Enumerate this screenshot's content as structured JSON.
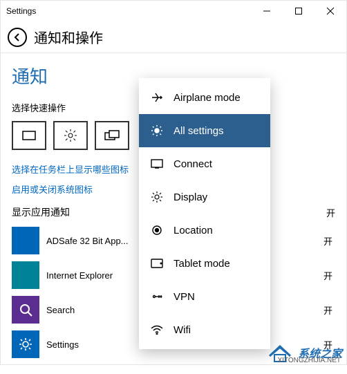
{
  "window": {
    "title": "Settings"
  },
  "header": {
    "page_title": "通知和操作"
  },
  "section": {
    "title": "通知",
    "quick_actions_label": "选择快速操作",
    "link_taskbar": "选择在任务栏上显示哪些图标",
    "link_system_icons": "启用或关闭系统图标",
    "apps_header": "显示应用通知",
    "apps_toggle": "开"
  },
  "apps": [
    {
      "name": "ADSafe 32 Bit App...",
      "toggle": "开",
      "color": "blue"
    },
    {
      "name": "Internet Explorer",
      "toggle": "开",
      "color": "teal"
    },
    {
      "name": "Search",
      "toggle": "开",
      "color": "purple"
    },
    {
      "name": "Settings",
      "toggle": "开",
      "color": "blue"
    }
  ],
  "popup": {
    "items": [
      {
        "icon": "airplane-icon",
        "label": "Airplane mode",
        "selected": false
      },
      {
        "icon": "settings-icon",
        "label": "All settings",
        "selected": true
      },
      {
        "icon": "connect-icon",
        "label": "Connect",
        "selected": false
      },
      {
        "icon": "display-icon",
        "label": "Display",
        "selected": false
      },
      {
        "icon": "location-icon",
        "label": "Location",
        "selected": false
      },
      {
        "icon": "tablet-icon",
        "label": "Tablet mode",
        "selected": false
      },
      {
        "icon": "vpn-icon",
        "label": "VPN",
        "selected": false
      },
      {
        "icon": "wifi-icon",
        "label": "Wifi",
        "selected": false
      }
    ]
  },
  "watermark": {
    "text": "系统之家",
    "url": "XITONGZHIJIA.NET"
  }
}
